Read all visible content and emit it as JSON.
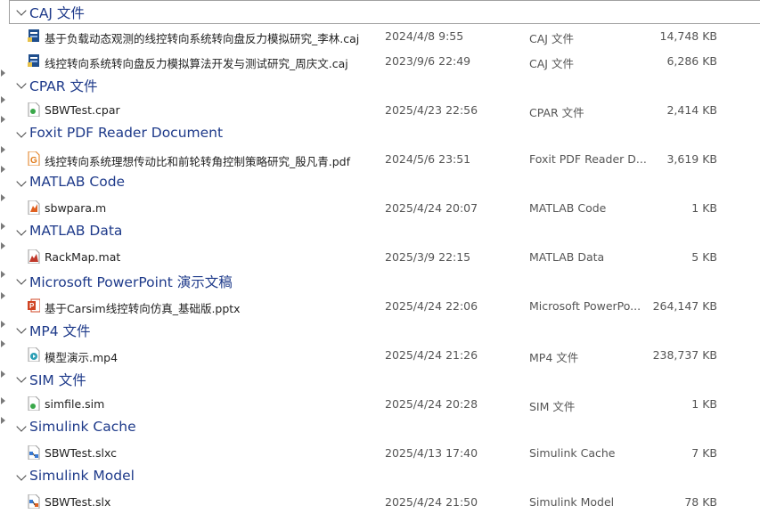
{
  "groups": [
    {
      "name": "CAJ 文件",
      "files": [
        {
          "name": "基于负载动态观测的线控转向系统转向盘反力模拟研究_李林.caj",
          "date": "2024/4/8 9:55",
          "type": "CAJ 文件",
          "size": "14,748 KB",
          "icon": "caj-file-icon"
        },
        {
          "name": "线控转向系统转向盘反力模拟算法开发与测试研究_周庆文.caj",
          "date": "2023/9/6 22:49",
          "type": "CAJ 文件",
          "size": "6,286 KB",
          "icon": "caj-file-icon"
        }
      ]
    },
    {
      "name": "CPAR 文件",
      "files": [
        {
          "name": "SBWTest.cpar",
          "date": "2025/4/23 22:56",
          "type": "CPAR 文件",
          "size": "2,414 KB",
          "icon": "cpar-file-icon"
        }
      ]
    },
    {
      "name": "Foxit PDF Reader Document",
      "files": [
        {
          "name": "线控转向系统理想传动比和前轮转角控制策略研究_殷凡青.pdf",
          "date": "2024/5/6 23:51",
          "type": "Foxit PDF Reader D...",
          "size": "3,619 KB",
          "icon": "pdf-file-icon"
        }
      ]
    },
    {
      "name": "MATLAB Code",
      "files": [
        {
          "name": "sbwpara.m",
          "date": "2025/4/24 20:07",
          "type": "MATLAB Code",
          "size": "1 KB",
          "icon": "matlab-code-icon"
        }
      ]
    },
    {
      "name": "MATLAB Data",
      "files": [
        {
          "name": "RackMap.mat",
          "date": "2025/3/9 22:15",
          "type": "MATLAB Data",
          "size": "5 KB",
          "icon": "matlab-data-icon"
        }
      ]
    },
    {
      "name": "Microsoft PowerPoint 演示文稿",
      "files": [
        {
          "name": "基于Carsim线控转向仿真_基础版.pptx",
          "date": "2025/4/24 22:06",
          "type": "Microsoft PowerPo...",
          "size": "264,147 KB",
          "icon": "pptx-file-icon"
        }
      ]
    },
    {
      "name": "MP4 文件",
      "files": [
        {
          "name": "模型演示.mp4",
          "date": "2025/4/24 21:26",
          "type": "MP4 文件",
          "size": "238,737 KB",
          "icon": "mp4-file-icon"
        }
      ]
    },
    {
      "name": "SIM 文件",
      "files": [
        {
          "name": "simfile.sim",
          "date": "2025/4/24 20:28",
          "type": "SIM 文件",
          "size": "1 KB",
          "icon": "sim-file-icon"
        }
      ]
    },
    {
      "name": "Simulink Cache",
      "files": [
        {
          "name": "SBWTest.slxc",
          "date": "2025/4/13 17:40",
          "type": "Simulink Cache",
          "size": "7 KB",
          "icon": "simulink-cache-icon"
        }
      ]
    },
    {
      "name": "Simulink Model",
      "files": [
        {
          "name": "SBWTest.slx",
          "date": "2025/4/24 21:50",
          "type": "Simulink Model",
          "size": "78 KB",
          "icon": "simulink-model-icon"
        }
      ]
    }
  ],
  "colors": {
    "group_header": "#1e3a8a",
    "border": "#a0a0a0",
    "caj_icon": "#1f4e8c",
    "pdf_icon": "#e07b1a",
    "pptx_icon": "#d04423",
    "mp4_icon": "#2c9fb5",
    "matlab_icon": "#e06020",
    "simulink_icon": "#3a7bd5"
  }
}
